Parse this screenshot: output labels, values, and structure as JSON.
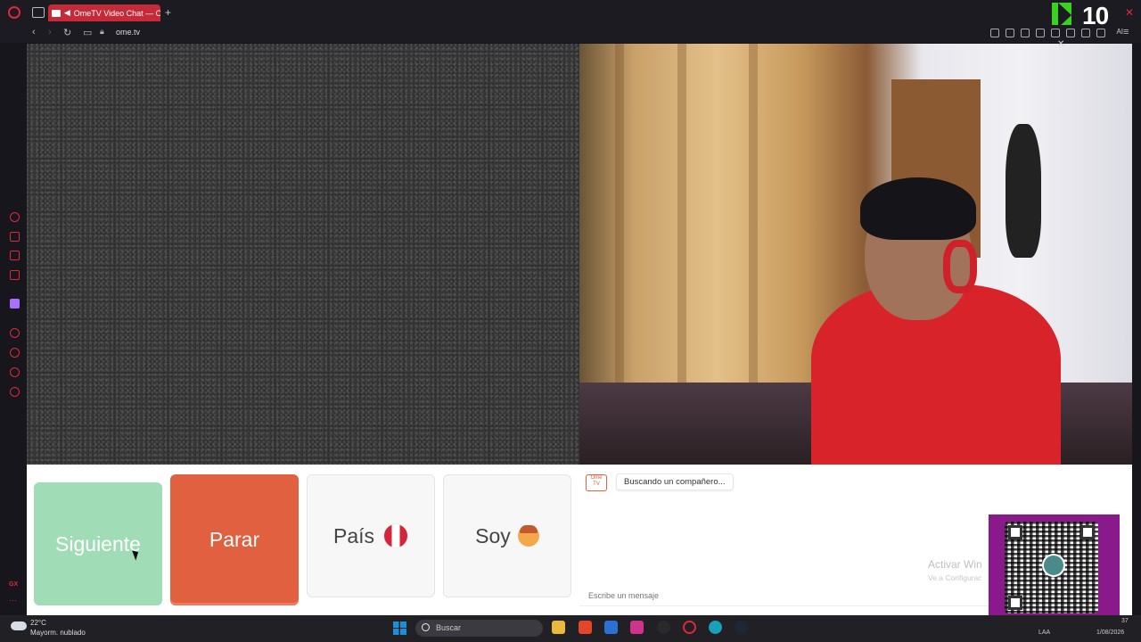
{
  "browser": {
    "tab_title": "OmeTV Video Chat — O",
    "new_tab_symbol": "+",
    "url": "ome.tv",
    "badge_number": "10",
    "ai_label": "AI"
  },
  "controls": {
    "next_label": "Siguiente",
    "stop_label": "Parar",
    "country_label": "País",
    "soy_label": "Soy"
  },
  "chat": {
    "logo_text": "Ome TV",
    "status_message": "Buscando un compañero...",
    "input_placeholder": "Escribe un mensaje",
    "watermark_line1": "Activar Win",
    "watermark_line2": "Ve a Configurac"
  },
  "taskbar": {
    "weather_temp": "22°C",
    "weather_desc": "Mayorm. nublado",
    "search_placeholder": "Buscar",
    "lang": "LAA",
    "time_fragment": "37",
    "date": "1/08/2026"
  },
  "colors": {
    "brand_red": "#c42a37",
    "next_green": "#a0ddb6",
    "stop_orange": "#e06040",
    "qr_purple": "#8a1a8c"
  }
}
